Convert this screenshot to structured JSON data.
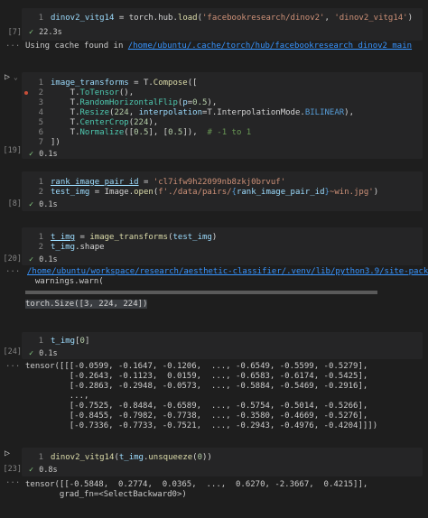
{
  "cell1": {
    "exec_count": "[7]",
    "line1": "1",
    "code": {
      "v": "dinov2_vitg14",
      "eq": " = torch.hub.",
      "fn": "load",
      "p1": "(",
      "s1": "'facebookresearch/dinov2'",
      "c": ", ",
      "s2": "'dinov2_vitg14'",
      "p2": ")"
    },
    "time": "22.3s",
    "output_prefix": "Using cache found in ",
    "output_link": "/home/ubuntu/.cache/torch/hub/facebookresearch_dinov2_main"
  },
  "cell2": {
    "exec_count": "[19]",
    "lines": [
      "1",
      "2",
      "3",
      "4",
      "5",
      "6",
      "7"
    ],
    "l1": {
      "v": "image_transforms",
      "eq": " = T.",
      "fn": "Compose",
      "p": "(["
    },
    "l2": {
      "pre": "    T.",
      "fn": "ToTensor",
      "p": "(),"
    },
    "l3": {
      "pre": "    T.",
      "fn": "RandomHorizontalFlip",
      "a": "(",
      "k": "p",
      "eq": "=",
      "n": "0.5",
      "b": "),"
    },
    "l4": {
      "pre": "    T.",
      "fn": "Resize",
      "a": "(",
      "n": "224",
      "c": ", ",
      "k": "interpolation",
      "eq": "=T.InterpolationMode.",
      "e": "BILINEAR",
      "b": "),"
    },
    "l5": {
      "pre": "    T.",
      "fn": "CenterCrop",
      "a": "(",
      "n": "224",
      "b": "),"
    },
    "l6": {
      "pre": "    T.",
      "fn": "Normalize",
      "a": "([",
      "n1": "0.5",
      "m": "], [",
      "n2": "0.5",
      "b": "]),",
      "com": "  # -1 to 1"
    },
    "l7": {
      "p": "])"
    },
    "time": "0.1s"
  },
  "cell3": {
    "exec_count": "[8]",
    "lines": [
      "1",
      "2"
    ],
    "l1": {
      "v": "rank_image_pair_id",
      "eq": " = ",
      "s": "'cl7ifw9h22099nb8zkj0brvuf'"
    },
    "l2": {
      "v": "test_img",
      "eq": " = Image.",
      "fn": "open",
      "a": "(",
      "s": "f'./data/pairs/",
      "b": "{",
      "x": "rank_image_pair_id",
      "c": "}",
      "s2": "~win.jpg'",
      "d": ")"
    },
    "time": "0.1s"
  },
  "cell4": {
    "exec_count": "[20]",
    "lines": [
      "1",
      "2"
    ],
    "l1": {
      "v": "t_img",
      "eq": " = ",
      "fn": "image_transforms",
      "a": "(",
      "x": "test_img",
      "b": ")"
    },
    "l2": {
      "v": "t_img",
      "rest": ".shape"
    },
    "time": "0.1s",
    "warn_link": "/home/ubuntu/workspace/research/aesthetic-classifier/.venv/lib/python3.9/site-packages/torchvision/transform",
    "warn_text": "  warnings.warn(",
    "result": "torch.Size([3, 224, 224])"
  },
  "cell5": {
    "exec_count": "[24]",
    "lines": [
      "1"
    ],
    "l1": {
      "v": "t_img",
      "rest": "[",
      "n": "0",
      "e": "]"
    },
    "time": "0.1s",
    "output": [
      "tensor([[[-0.0599, -0.1647, -0.1206,  ..., -0.6549, -0.5599, -0.5279],",
      "         [-0.2643, -0.1123,  0.0159,  ..., -0.6583, -0.6174, -0.5425],",
      "         [-0.2863, -0.2948, -0.0573,  ..., -0.5884, -0.5469, -0.2916],",
      "         ...,",
      "         [-0.7525, -0.8484, -0.6589,  ..., -0.5754, -0.5014, -0.5266],",
      "         [-0.8455, -0.7982, -0.7738,  ..., -0.3580, -0.4669, -0.5276],",
      "         [-0.7336, -0.7733, -0.7521,  ..., -0.2943, -0.4976, -0.4204]]])"
    ]
  },
  "cell6": {
    "exec_count": "[23]",
    "lines": [
      "1"
    ],
    "l1": {
      "fn": "dinov2_vitg14",
      "a": "(",
      "v": "t_img",
      "m": ".",
      "fn2": "unsqueeze",
      "b": "(",
      "n": "0",
      "c": "))"
    },
    "time": "0.8s",
    "output": [
      "tensor([[-0.5848,  0.2774,  0.0365,  ...,  0.6270, -2.3667,  0.4215]],",
      "       grad_fn=<SelectBackward0>)"
    ]
  },
  "ellipsis": "...",
  "icons": {
    "check": "check-icon",
    "run": "run-icon",
    "fold": "chevron-down-icon",
    "breakpoint": "breakpoint-dot-icon"
  },
  "colors": {
    "background": "#1e1e1e",
    "editor": "#252526",
    "success": "#89d185",
    "link": "#3794ff",
    "keyword": "#569cd6",
    "string": "#ce9178"
  }
}
